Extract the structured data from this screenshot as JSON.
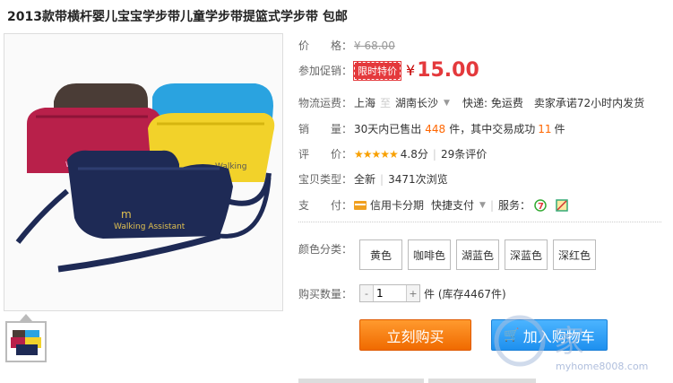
{
  "title": "2013款带横杆婴儿宝宝学步带儿童学步带提篮式学步带 包邮",
  "price": {
    "label": "价　　格：",
    "yen": "¥",
    "value": "68.00"
  },
  "promo": {
    "label": "参加促销：",
    "tag": "限时特价",
    "yen": "¥",
    "value": "15.00"
  },
  "shipping": {
    "label": "物流运费：",
    "from": "上海",
    "sep": "至",
    "to": "湖南长沙",
    "express": "快递: 免运费",
    "note": "卖家承诺72小时内发货"
  },
  "sales": {
    "label": "销　　量：",
    "pre": "30天内已售出",
    "count": "448",
    "mid": "件，其中交易成功",
    "success": "11",
    "unit": "件"
  },
  "rating": {
    "label": "评　　价：",
    "stars": "★★★★★",
    "score": "4.8分",
    "reviews": "29条评价"
  },
  "type": {
    "label": "宝贝类型：",
    "condition": "全新",
    "views": "3471次浏览"
  },
  "payment": {
    "label": "支　　付：",
    "credit": "信用卡分期",
    "quick": "快捷支付",
    "service": "服务："
  },
  "color": {
    "label": "颜色分类：",
    "options": [
      "黄色",
      "咖啡色",
      "湖蓝色",
      "深蓝色",
      "深红色"
    ]
  },
  "quantity": {
    "label": "购买数量：",
    "minus": "-",
    "value": "1",
    "plus": "+",
    "stock": "件 (库存4467件)"
  },
  "buttons": {
    "buy": "立刻购买",
    "cart": "加入购物车"
  },
  "watermark": {
    "text": "家",
    "url": "myhome8008.com"
  }
}
